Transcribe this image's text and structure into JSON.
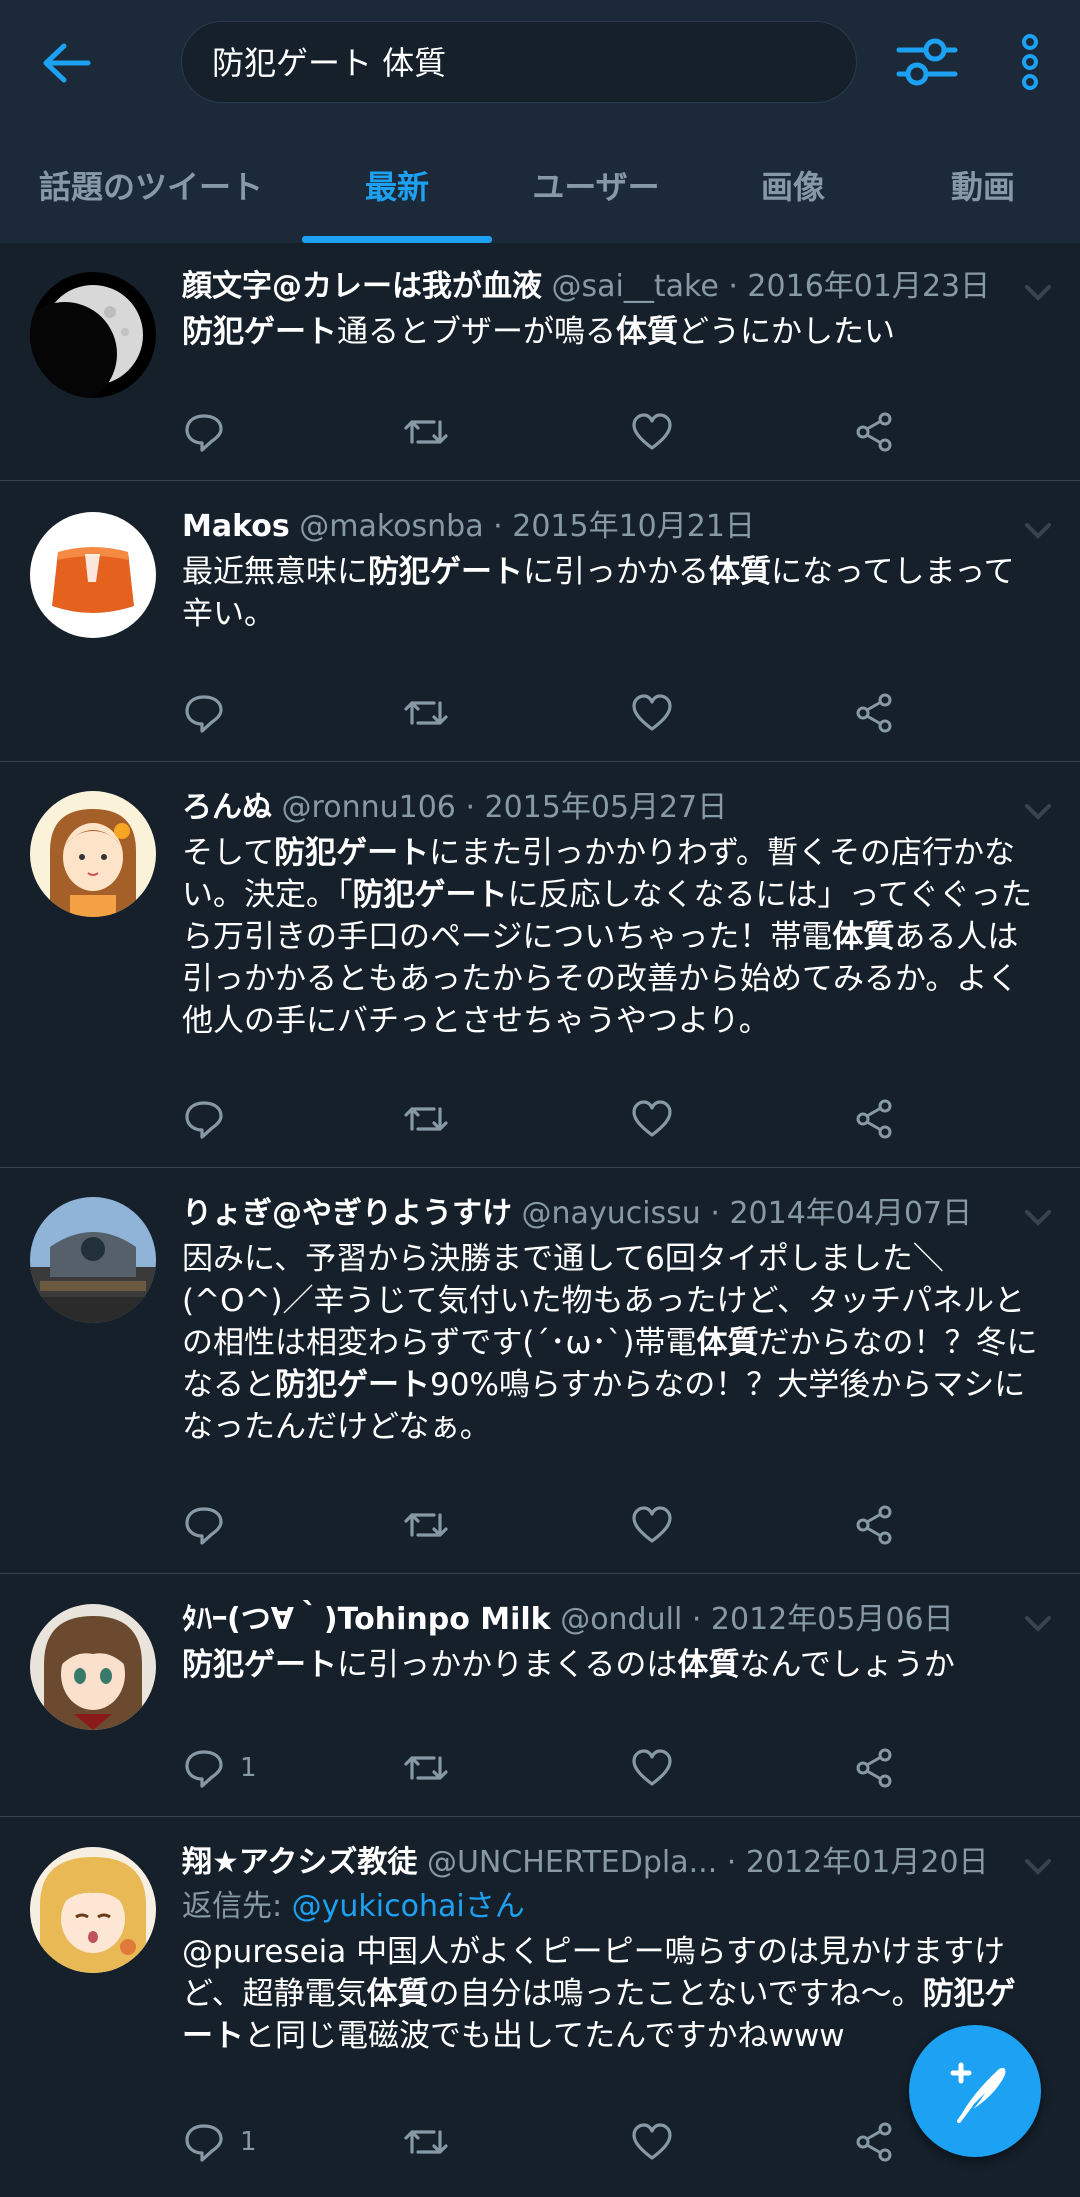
{
  "search": {
    "query": "防犯ゲート 体質"
  },
  "tabs": [
    {
      "label": "話題のツイート"
    },
    {
      "label": "最新"
    },
    {
      "label": "ユーザー"
    },
    {
      "label": "画像"
    },
    {
      "label": "動画"
    }
  ],
  "colors": {
    "accent": "#1da1f2",
    "background": "#15202b",
    "header": "#1c2938",
    "muted": "#8899a6"
  },
  "tweets": [
    {
      "name": "顔文字@カレーは我が血液",
      "handle": "@sai__take",
      "date": "· 2016年01月23日",
      "segments": [
        {
          "t": "防犯ゲート",
          "b": true
        },
        {
          "t": "通るとブザーが鳴る",
          "b": false
        },
        {
          "t": "体質",
          "b": true
        },
        {
          "t": "どうにかしたい",
          "b": false
        }
      ],
      "reply_count": "",
      "avatar": "moon-avatar"
    },
    {
      "name": "Makos",
      "handle": "@makosnba",
      "date": "· 2015年10月21日",
      "segments": [
        {
          "t": "最近無意味に",
          "b": false
        },
        {
          "t": "防犯ゲート",
          "b": true
        },
        {
          "t": "に引っかかる",
          "b": false
        },
        {
          "t": "体質",
          "b": true
        },
        {
          "t": "になってしまって辛い。",
          "b": false
        }
      ],
      "reply_count": "",
      "avatar": "orange-object-avatar"
    },
    {
      "name": "ろんぬ",
      "handle": "@ronnu106",
      "date": "· 2015年05月27日",
      "segments": [
        {
          "t": "そして",
          "b": false
        },
        {
          "t": "防犯ゲート",
          "b": true
        },
        {
          "t": "にまた引っかかりわず。暫くその店行かない。決定。「",
          "b": false
        },
        {
          "t": "防犯ゲート",
          "b": true
        },
        {
          "t": "に反応しなくなるには」ってぐぐったら万引きの手口のページについちゃった！帯電",
          "b": false
        },
        {
          "t": "体質",
          "b": true
        },
        {
          "t": "ある人は引っかかるともあったからその改善から始めてみるか。よく他人の手にバチっとさせちゃうやつより。",
          "b": false
        }
      ],
      "reply_count": "",
      "avatar": "girl-illustration-avatar"
    },
    {
      "name": "りょぎ@やぎりようすけ",
      "handle": "@nayucissu",
      "date": "· 2014年04月07日",
      "segments": [
        {
          "t": "因みに、予習から決勝まで通して6回タイポしました＼(^O^)／辛うじて気付いた物もあったけど、タッチパネルとの相性は相変わらずです(´･ω･`)帯電",
          "b": false
        },
        {
          "t": "体質",
          "b": true
        },
        {
          "t": "だからなの！？冬になると",
          "b": false
        },
        {
          "t": "防犯ゲート",
          "b": true
        },
        {
          "t": "90%鳴らすからなの！？大学後からマシになったんだけどなぁ。",
          "b": false
        }
      ],
      "reply_count": "",
      "avatar": "building-photo-avatar"
    },
    {
      "name": "ﾀﾊｰ(つ∀｀)Tohinpo Milk",
      "handle": "@ondull",
      "date": "· 2012年05月06日",
      "segments": [
        {
          "t": "防犯ゲート",
          "b": true
        },
        {
          "t": "に引っかかりまくるのは",
          "b": false
        },
        {
          "t": "体質",
          "b": true
        },
        {
          "t": "なんでしょうか",
          "b": false
        }
      ],
      "reply_count": "1",
      "avatar": "anime-girl-avatar"
    },
    {
      "name": "翔★アクシズ教徒",
      "handle": "@UNCHERTEDpla...",
      "date": "· 2012年01月20日",
      "reply_to_prefix": "返信先: ",
      "reply_to_link": "@yukicohaiさん",
      "segments": [
        {
          "t": "@pureseia 中国人がよくピーピー鳴らすのは見かけますけど、超静電気",
          "b": false
        },
        {
          "t": "体質",
          "b": true
        },
        {
          "t": "の自分は鳴ったことないですね〜。",
          "b": false
        },
        {
          "t": "防犯ゲート",
          "b": true
        },
        {
          "t": "と同じ電磁波でも出してたんですかねwww",
          "b": false
        }
      ],
      "reply_count": "1",
      "avatar": "blonde-anime-avatar"
    }
  ]
}
